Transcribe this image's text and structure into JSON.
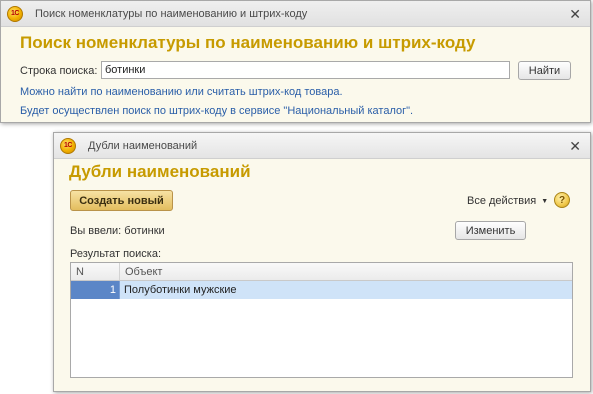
{
  "search_window": {
    "title": "Поиск номенклатуры по наименованию и штрих-коду",
    "heading": "Поиск номенклатуры по наименованию и штрих-коду",
    "search_label": "Строка поиска:",
    "search_value": "ботинки",
    "find_button": "Найти",
    "hint_1": "Можно найти по наименованию или считать штрих-код товара.",
    "hint_2": "Будет осуществлен поиск по штрих-коду в сервисе \"Национальный каталог\".",
    "close_glyph": "✕"
  },
  "dup_window": {
    "title": "Дубли наименований",
    "heading": "Дубли наименований",
    "create_button": "Создать новый",
    "all_actions": "Все действия",
    "help_glyph": "?",
    "entered_label": "Вы ввели: ботинки",
    "change_button": "Изменить",
    "results_label": "Результат поиска:",
    "close_glyph": "✕",
    "table": {
      "columns": [
        "N",
        "Объект"
      ],
      "rows": [
        {
          "n": "1",
          "object": "Полуботинки мужские"
        }
      ]
    }
  },
  "logo_text": "1С",
  "colors": {
    "heading": "#c79b00",
    "hint": "#2a5ea8",
    "selected_row": "#cfe3f8",
    "selected_cell": "#5b86c7",
    "primary_button": "#e3bd5e"
  }
}
